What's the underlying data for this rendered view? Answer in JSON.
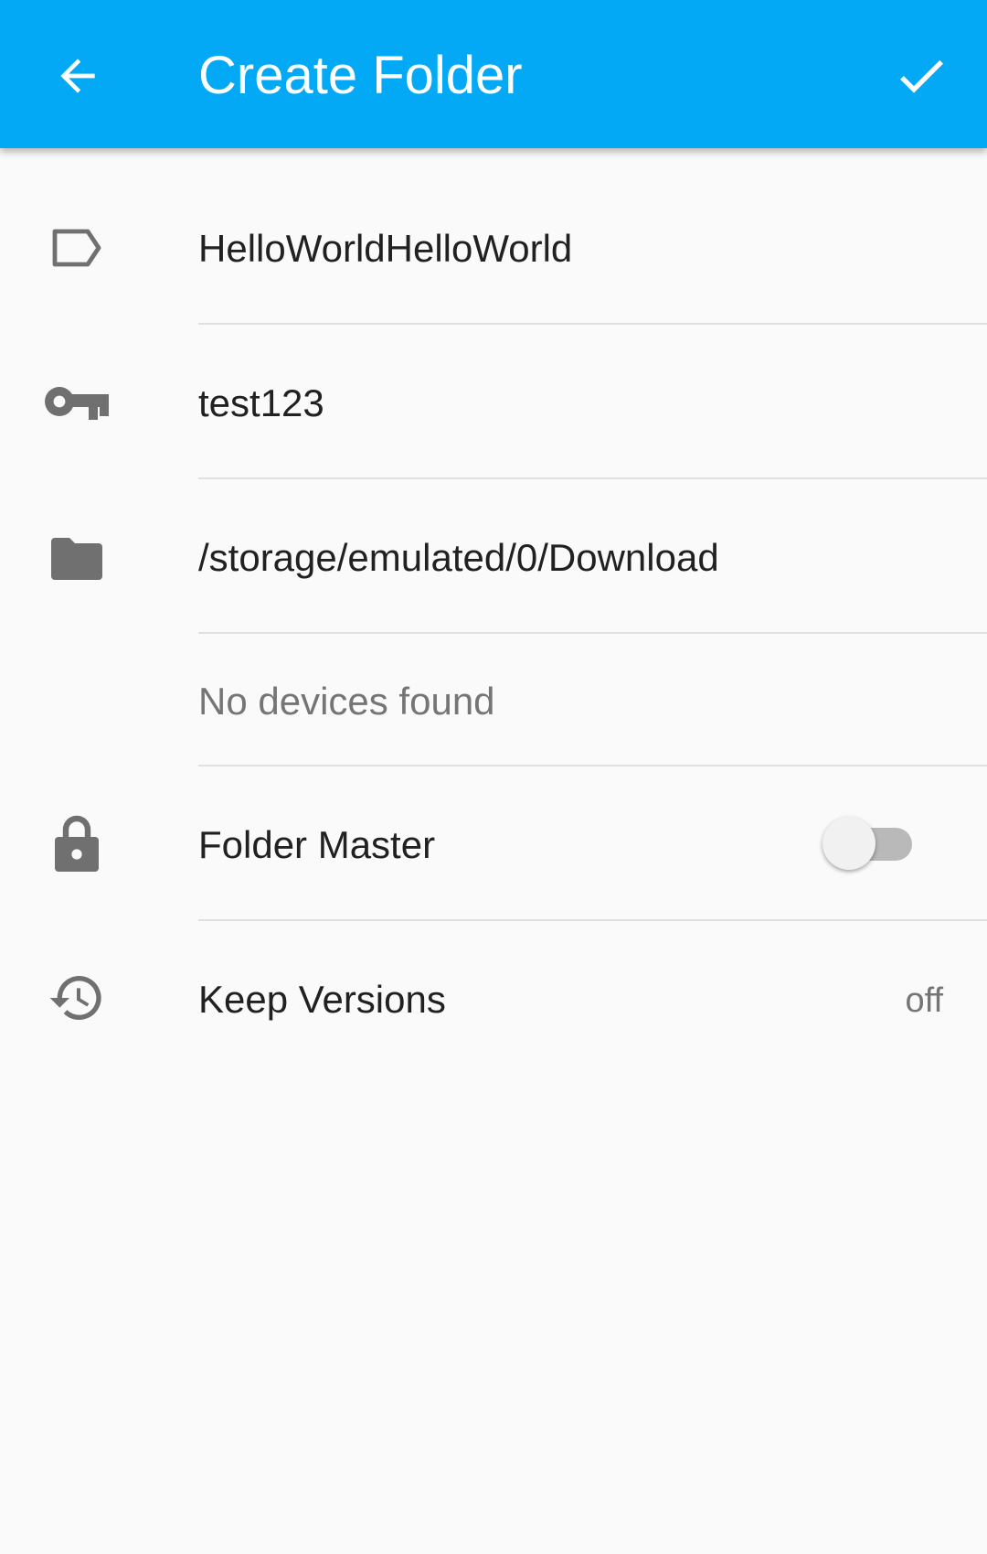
{
  "header": {
    "title": "Create Folder",
    "back_icon": "arrow-left-icon",
    "confirm_icon": "check-icon",
    "background": "#03a9f4"
  },
  "fields": {
    "label": {
      "icon": "label-tag-icon",
      "value": "HelloWorldHelloWorld"
    },
    "folder_id": {
      "icon": "key-icon",
      "value": "test123"
    },
    "directory": {
      "icon": "folder-icon",
      "value": "/storage/emulated/0/Download"
    },
    "devices": {
      "hint": "No devices found"
    },
    "folder_master": {
      "icon": "lock-icon",
      "label": "Folder Master",
      "enabled": false
    },
    "keep_versions": {
      "icon": "history-icon",
      "label": "Keep Versions",
      "value": "off"
    }
  }
}
